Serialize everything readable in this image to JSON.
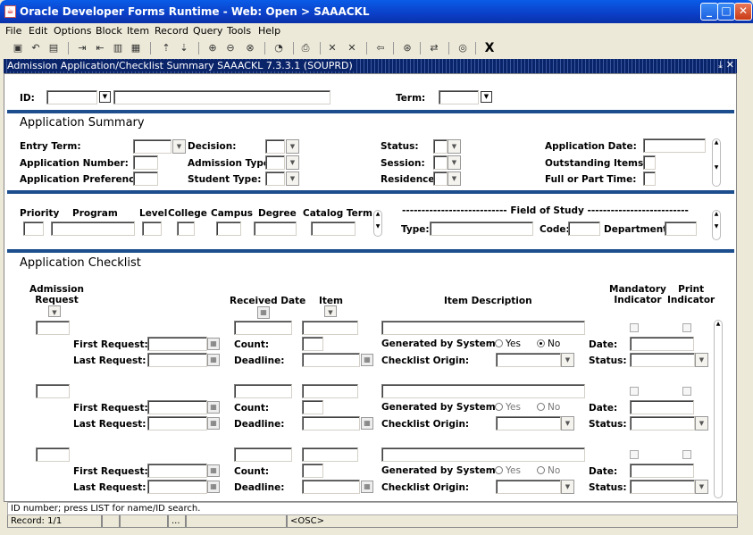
{
  "window": {
    "title": "Oracle Developer Forms Runtime - Web:  Open > SAAACKL"
  },
  "menu": [
    "File",
    "Edit",
    "Options",
    "Block",
    "Item",
    "Record",
    "Query",
    "Tools",
    "Help"
  ],
  "inner_title": "Admission Application/Checklist Summary  SAAACKL  7.3.3.1  (SOUPRD)",
  "key": {
    "id_label": "ID:",
    "term_label": "Term:",
    "id_value": "",
    "term_value": ""
  },
  "app_summary": {
    "title": "Application Summary",
    "entry_term": "Entry Term:",
    "application_number": "Application Number:",
    "application_preference": "Application Preference:",
    "decision": "Decision:",
    "admission_type": "Admission Type:",
    "student_type": "Student Type:",
    "status": "Status:",
    "session": "Session:",
    "residence": "Residence:",
    "application_date": "Application Date:",
    "outstanding_items": "Outstanding  Items:",
    "full_part_time": "Full or Part Time:"
  },
  "curriculum": {
    "priority": "Priority",
    "program": "Program",
    "level": "Level",
    "college": "College",
    "campus": "Campus",
    "degree": "Degree",
    "catalog_term": "Catalog Term",
    "field_of_study": "--------------------------- Field of Study --------------------------",
    "type": "Type:",
    "code": "Code:",
    "department": "Department:"
  },
  "checklist": {
    "title": "Application Checklist",
    "admission_request": "Admission\nRequest",
    "received_date": "Received Date",
    "item": "Item",
    "item_description": "Item Description",
    "mandatory_indicator": "Mandatory\nIndicator",
    "print_indicator": "Print\nIndicator",
    "first_request": "First Request:",
    "last_request": "Last Request:",
    "count": "Count:",
    "deadline": "Deadline:",
    "generated_by_system": "Generated by System:",
    "checklist_origin": "Checklist Origin:",
    "date": "Date:",
    "status": "Status:",
    "yes": "Yes",
    "no": "No",
    "rows": [
      {
        "generated": "no",
        "enabled": true
      },
      {
        "generated": "none",
        "enabled": false
      },
      {
        "generated": "none",
        "enabled": false
      }
    ]
  },
  "status": {
    "message": "ID number; press LIST for name/ID search.",
    "record": "Record: 1/1",
    "dots": "...",
    "osc": "<OSC>"
  }
}
